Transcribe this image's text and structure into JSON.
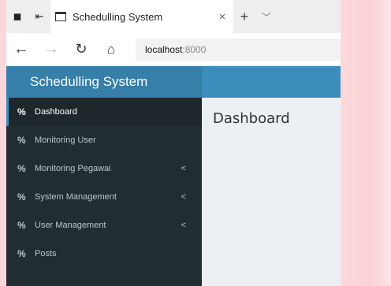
{
  "browser": {
    "tab_title": "Schedulling System",
    "tab_close": "×",
    "new_tab": "+",
    "tab_list": "﹀",
    "address_host": "localhost",
    "address_port": ":8000"
  },
  "app": {
    "brand": "Schedulling System",
    "page_title": "Dashboard",
    "colors": {
      "header": "#3c8dbc",
      "brand": "#367fa9",
      "sidebar": "#222d32",
      "content": "#ecf0f5"
    }
  },
  "sidebar": {
    "items": [
      {
        "label": "Dashboard",
        "icon": "link-icon",
        "active": true,
        "caret": ""
      },
      {
        "label": "Monitoring User",
        "icon": "link-icon",
        "active": false,
        "caret": ""
      },
      {
        "label": "Monitoring Pegawai",
        "icon": "link-icon",
        "active": false,
        "caret": "<"
      },
      {
        "label": "System Management",
        "icon": "link-icon",
        "active": false,
        "caret": "<"
      },
      {
        "label": "User Management",
        "icon": "link-icon",
        "active": false,
        "caret": "<"
      },
      {
        "label": "Posts",
        "icon": "link-icon",
        "active": false,
        "caret": ""
      }
    ]
  }
}
